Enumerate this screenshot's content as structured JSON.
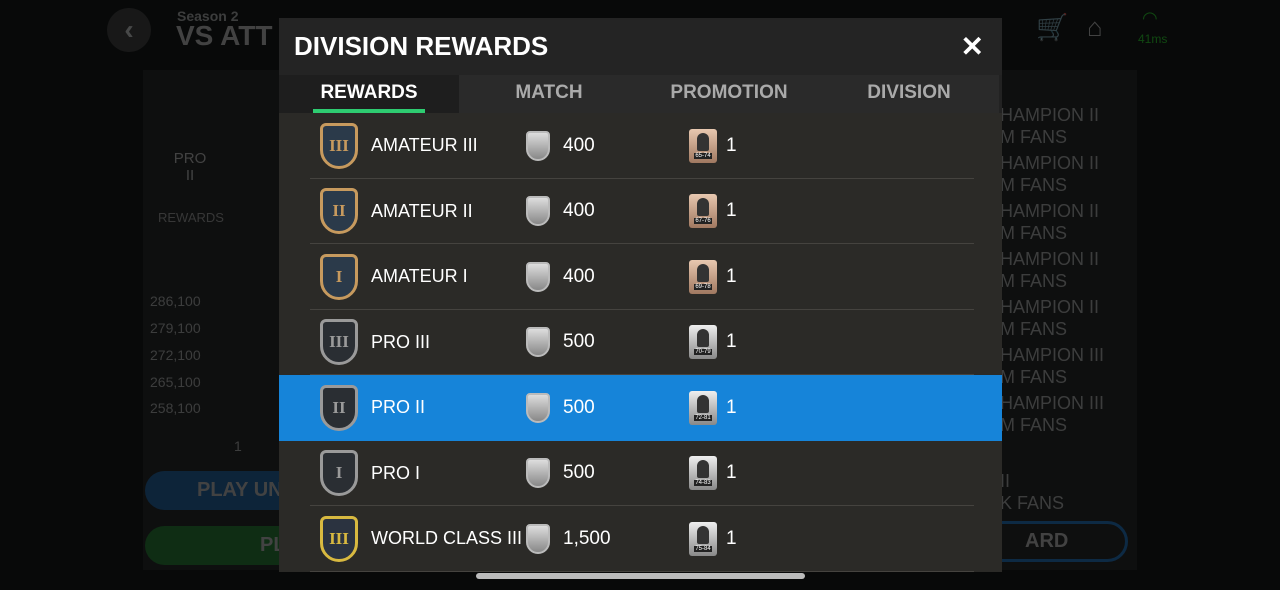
{
  "background": {
    "season": "Season 2",
    "title": "VS ATT",
    "rank": {
      "tier": "PRO",
      "level": "II"
    },
    "rewards_label": "REWARDS",
    "chart_ticks": [
      "286,100",
      "279,100",
      "272,100",
      "265,100",
      "258,100"
    ],
    "chart_x": "1",
    "play_button": "PLAY UN",
    "play_button2": "PL",
    "right_items": [
      "HAMPION II",
      "M FANS",
      "HAMPION II",
      "M FANS",
      "HAMPION II",
      "M FANS",
      "HAMPION II",
      "M FANS",
      "HAMPION II",
      "M FANS",
      "HAMPION III",
      "M FANS",
      "HAMPION III",
      "M FANS",
      "II",
      "K FANS"
    ],
    "leaderboard_button": "ARD",
    "ping": "41ms"
  },
  "modal": {
    "title": "DIVISION REWARDS",
    "close": "✕",
    "tabs": [
      {
        "label": "REWARDS",
        "active": true
      },
      {
        "label": "MATCH"
      },
      {
        "label": "PROMOTION"
      },
      {
        "label": "DIVISION"
      }
    ],
    "rows": [
      {
        "badge": "III",
        "tier": "amateur",
        "name": "AMATEUR III",
        "coins": "400",
        "card": "65-74",
        "qty": "1"
      },
      {
        "badge": "II",
        "tier": "amateur",
        "name": "AMATEUR II",
        "coins": "400",
        "card": "67-76",
        "qty": "1"
      },
      {
        "badge": "I",
        "tier": "amateur",
        "name": "AMATEUR I",
        "coins": "400",
        "card": "69-78",
        "qty": "1"
      },
      {
        "badge": "III",
        "tier": "pro",
        "name": "PRO III",
        "coins": "500",
        "card": "70-79",
        "qty": "1"
      },
      {
        "badge": "II",
        "tier": "pro",
        "name": "PRO II",
        "coins": "500",
        "card": "72-81",
        "qty": "1",
        "selected": true
      },
      {
        "badge": "I",
        "tier": "pro",
        "name": "PRO I",
        "coins": "500",
        "card": "74-83",
        "qty": "1"
      },
      {
        "badge": "III",
        "tier": "world",
        "name": "WORLD CLASS III",
        "coins": "1,500",
        "card": "75-84",
        "qty": "1"
      }
    ]
  },
  "colors": {
    "selected": "#1684d9",
    "tab_underline": "#2ecc71",
    "amateur": "#c79a5e",
    "pro": "#9a9a9a",
    "world": "#d8b940"
  }
}
